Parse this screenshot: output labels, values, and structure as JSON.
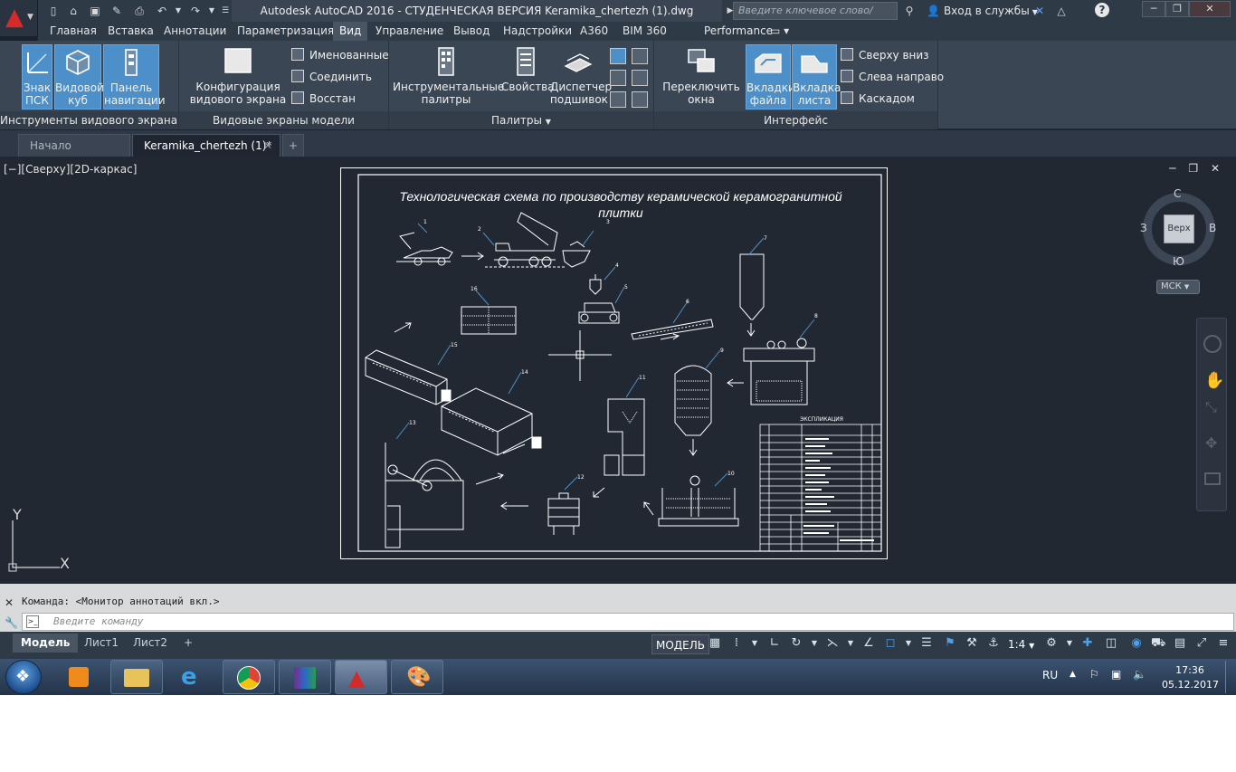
{
  "window": {
    "title": "Autodesk AutoCAD 2016 - СТУДЕНЧЕСКАЯ ВЕРСИЯ    Keramika_chertezh (1).dwg",
    "search_placeholder": "Введите ключевое слово/фразу",
    "signin": "Вход в службы"
  },
  "ribbon_tabs": [
    "Главная",
    "Вставка",
    "Аннотации",
    "Параметризация",
    "Вид",
    "Управление",
    "Вывод",
    "Надстройки",
    "A360",
    "BIM 360",
    "Performance"
  ],
  "ribbon": {
    "groups": {
      "viewport_tools": {
        "label": "Инструменты видового экрана",
        "ucs_icon": "Знак ПСК",
        "viewcube": "Видовой куб",
        "nav_bar": "Панель навигации"
      },
      "model_viewports": {
        "label": "Видовые экраны модели",
        "config": "Конфигурация видового экрана",
        "named": "Именованные",
        "join": "Соединить",
        "restore": "Восстан"
      },
      "palettes": {
        "label": "Палитры",
        "tool_palettes": "Инструментальные палитры",
        "properties": "Свойства",
        "sheet_manager": "Диспетчер подшивок"
      },
      "interface": {
        "label": "Интерфейс",
        "switch_windows": "Переключить окна",
        "file_tabs": "Вкладки файла",
        "layout_tabs": "Вкладка листа",
        "tile_horizontal": "Сверху вниз",
        "tile_vertical": "Слева направо",
        "cascade": "Каскадом"
      }
    }
  },
  "file_tabs": {
    "start": "Начало",
    "drawing": "Keramika_chertezh (1)*"
  },
  "viewport": {
    "label": "[−][Сверху][2D-каркас]",
    "viewcube": {
      "top": "Верх",
      "n": "С",
      "s": "Ю",
      "w": "З",
      "e": "В",
      "wcs": "МСК"
    },
    "ucs_x": "X",
    "ucs_y": "Y"
  },
  "drawing": {
    "title_line1": "Технологическая схема по производству керамической керамогранитной",
    "title_line2": "плитки",
    "spec_title": "ЭКСПЛИКАЦИЯ",
    "callouts": [
      "1",
      "2",
      "3",
      "4",
      "5",
      "6",
      "7",
      "8",
      "9",
      "10",
      "11",
      "12",
      "13",
      "14",
      "15",
      "16"
    ]
  },
  "command": {
    "history": "Команда:  <Монитор аннотаций вкл.>",
    "placeholder": "Введите команду"
  },
  "layout_tabs": [
    "Модель",
    "Лист1",
    "Лист2"
  ],
  "status": {
    "model": "МОДЕЛЬ",
    "scale": "1:4"
  },
  "taskbar": {
    "lang": "RU",
    "time": "17:36",
    "date": "05.12.2017"
  }
}
